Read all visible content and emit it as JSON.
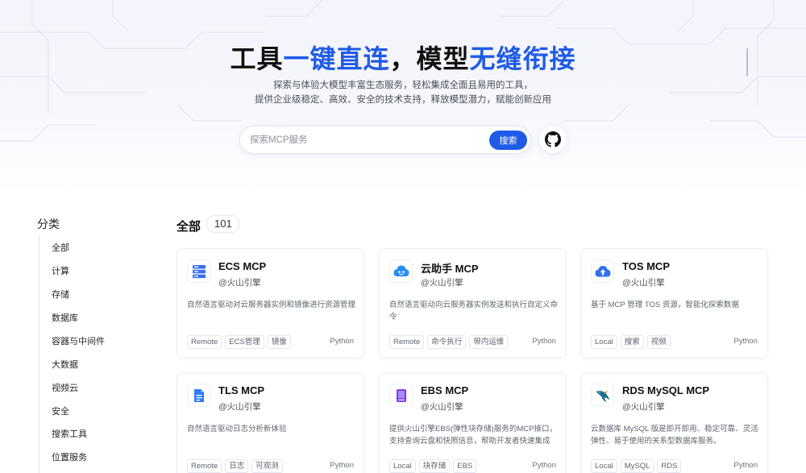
{
  "hero": {
    "title_part1": "工具",
    "title_part2": "一键直连",
    "title_part3": "，模型",
    "title_part4": "无缝衔接",
    "subtitle_line1": "探索与体验大模型丰富生态服务，轻松集成全面且易用的工具，",
    "subtitle_line2": "提供企业级稳定、高效、安全的技术支持，释放模型潜力，赋能创新应用"
  },
  "search": {
    "placeholder": "探索MCP服务",
    "button_label": "搜索"
  },
  "sidebar": {
    "title": "分类",
    "items": [
      {
        "label": "全部"
      },
      {
        "label": "计算"
      },
      {
        "label": "存储"
      },
      {
        "label": "数据库"
      },
      {
        "label": "容器与中间件"
      },
      {
        "label": "大数据"
      },
      {
        "label": "视频云"
      },
      {
        "label": "安全"
      },
      {
        "label": "搜索工具"
      },
      {
        "label": "位置服务"
      }
    ]
  },
  "main": {
    "section_title": "全部",
    "count": "101",
    "cards": [
      {
        "name": "ECS MCP",
        "org": "@火山引擎",
        "desc": "自然语言驱动对云服务器实例和镜像进行资源管理",
        "tags": [
          "Remote",
          "ECS管理",
          "镜像"
        ],
        "lang": "Python",
        "icon": "ecs-server-icon"
      },
      {
        "name": "云助手 MCP",
        "org": "@火山引擎",
        "desc": "自然语言驱动向云服务器实例发送和执行自定义命令",
        "tags": [
          "Remote",
          "命令执行",
          "带内运维"
        ],
        "lang": "Python",
        "icon": "cloud-assistant-icon"
      },
      {
        "name": "TOS MCP",
        "org": "@火山引擎",
        "desc": "基于 MCP 管理 TOS 资源，智能化探索数据",
        "tags": [
          "Local",
          "搜索",
          "视频"
        ],
        "lang": "Python",
        "icon": "tos-storage-icon"
      },
      {
        "name": "TLS MCP",
        "org": "@火山引擎",
        "desc": "自然语言驱动日志分析新体验",
        "tags": [
          "Remote",
          "日志",
          "可观测"
        ],
        "lang": "Python",
        "icon": "tls-log-icon"
      },
      {
        "name": "EBS MCP",
        "org": "@火山引擎",
        "desc": "提供火山引擎EBS(弹性块存储)服务的MCP接口，支持查询云盘和快照信息，帮助开发者快速集成EBS...",
        "tags": [
          "Local",
          "块存储",
          "EBS"
        ],
        "lang": "Python",
        "icon": "ebs-disk-icon"
      },
      {
        "name": "RDS MySQL MCP",
        "org": "@火山引擎",
        "desc": "云数据库 MySQL 版是即开即用、稳定可靠、灵活弹性、易于使用的关系型数据库服务。",
        "tags": [
          "Local",
          "MySQL",
          "RDS"
        ],
        "lang": "Python",
        "icon": "mysql-dolphin-icon"
      }
    ]
  },
  "colors": {
    "accent": "#1f5be6",
    "text": "#1f2329",
    "muted": "#5f6470"
  }
}
